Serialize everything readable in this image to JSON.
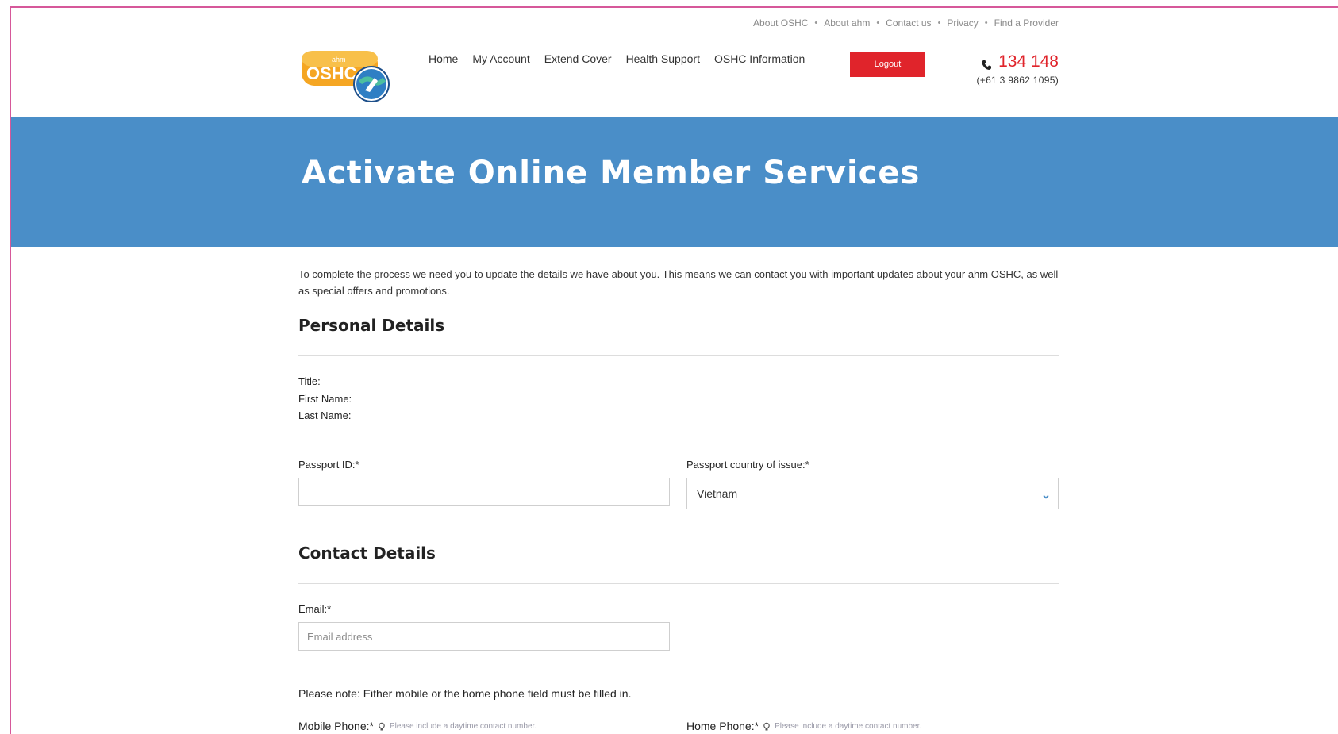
{
  "util_nav": {
    "items": [
      "About OSHC",
      "About ahm",
      "Contact us",
      "Privacy",
      "Find a Provider"
    ],
    "separator": "•"
  },
  "logo": {
    "small_text": "ahm",
    "main_text": "OSHC"
  },
  "main_nav": {
    "items": [
      "Home",
      "My Account",
      "Extend Cover",
      "Health Support",
      "OSHC Information"
    ]
  },
  "logout_label": "Logout",
  "phone": {
    "main": "134 148",
    "alt": "(+61 3 9862 1095)"
  },
  "hero": {
    "title": "Activate Online Member Services"
  },
  "intro_text": "To complete the process we need you to update the details we have about you. This means we can contact you with important updates about your ahm OSHC, as well as special offers and promotions.",
  "personal": {
    "heading": "Personal Details",
    "title_label": "Title:",
    "first_name_label": "First Name:",
    "last_name_label": "Last Name:",
    "passport_id_label": "Passport ID:*",
    "passport_id_value": "",
    "passport_country_label": "Passport country of issue:*",
    "passport_country_value": "Vietnam"
  },
  "contact": {
    "heading": "Contact Details",
    "email_label": "Email:*",
    "email_placeholder": "Email address",
    "note": "Please note: Either mobile or the home phone field must be filled in.",
    "mobile_label": "Mobile Phone:*",
    "mobile_help": "Please include a daytime contact number.",
    "home_label": "Home Phone:*",
    "home_help": "Please include a daytime contact number."
  },
  "colors": {
    "brand_red": "#e0242b",
    "hero_blue": "#4a8ec8",
    "frame_pink": "#d6589a"
  }
}
